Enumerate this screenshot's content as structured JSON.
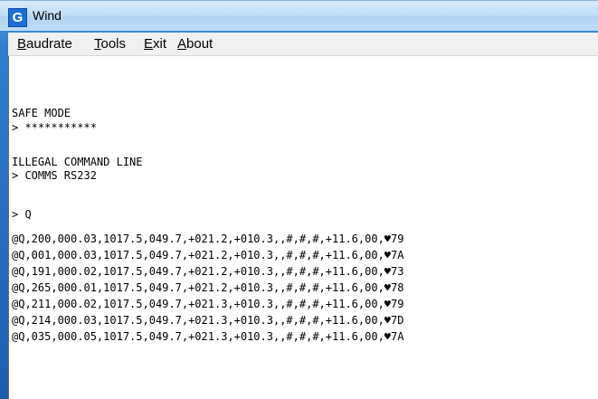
{
  "window": {
    "icon_letter": "G",
    "title": "Wind"
  },
  "menu": {
    "items": [
      {
        "prefix": "",
        "accel": "B",
        "rest": "audrate"
      },
      {
        "prefix": "",
        "accel": "T",
        "rest": "ools"
      },
      {
        "prefix": "",
        "accel": "E",
        "rest": "xit"
      },
      {
        "prefix": "",
        "accel": "A",
        "rest": "bout"
      }
    ]
  },
  "console": {
    "lines": [
      "SAFE MODE",
      "> ***********",
      "ILLEGAL COMMAND LINE",
      "> COMMS RS232",
      "> Q",
      "@Q,200,000.03,1017.5,049.7,+021.2,+010.3,,#,#,#,+11.6,00,♥79",
      "@Q,001,000.03,1017.5,049.7,+021.2,+010.3,,#,#,#,+11.6,00,♥7A",
      "@Q,191,000.02,1017.5,049.7,+021.2,+010.3,,#,#,#,+11.6,00,♥73",
      "@Q,265,000.01,1017.5,049.7,+021.2,+010.3,,#,#,#,+11.6,00,♥78",
      "@Q,211,000.02,1017.5,049.7,+021.3,+010.3,,#,#,#,+11.6,00,♥79",
      "@Q,214,000.03,1017.5,049.7,+021.3,+010.3,,#,#,#,+11.6,00,♥7D",
      "@Q,035,000.05,1017.5,049.7,+021.3,+010.3,,#,#,#,+11.6,00,♥7A"
    ]
  },
  "colors": {
    "title_gradient_top": "#d7ebfb",
    "frame_blue": "#2f7fcf",
    "menu_bg": "#f0f0f0",
    "console_bg": "#ffffff",
    "text": "#000000"
  }
}
